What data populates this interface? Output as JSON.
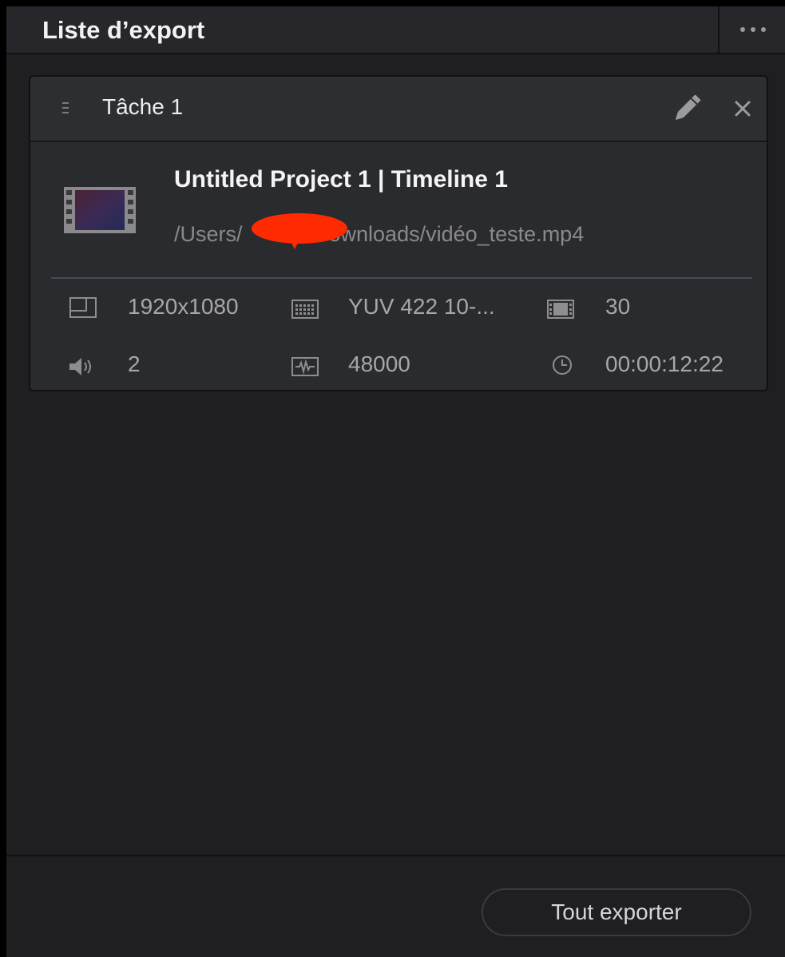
{
  "panel": {
    "title": "Liste d’export",
    "more_icon": "ellipsis-icon"
  },
  "job": {
    "title": "Tâche 1",
    "project": "Untitled Project 1 | Timeline 1",
    "path": "/Users/   /Downloads/vidéo_teste.mp4",
    "icons": {
      "drag": "drag-handle-icon",
      "edit": "pencil-icon",
      "close": "close-icon",
      "thumbnail": "film-thumbnail-icon"
    }
  },
  "specs": {
    "resolution": "1920x1080",
    "codec": "YUV 422 10-...",
    "framerate": "30",
    "audio_channels": "2",
    "sample_rate": "48000",
    "duration": "00:00:12:22"
  },
  "footer": {
    "export_all_label": "Tout exporter"
  },
  "colors": {
    "background": "#1f1f22",
    "card": "#2a2b2f",
    "text": "#ededed",
    "muted": "#a7a7aa",
    "redaction": "#ff2a00"
  }
}
